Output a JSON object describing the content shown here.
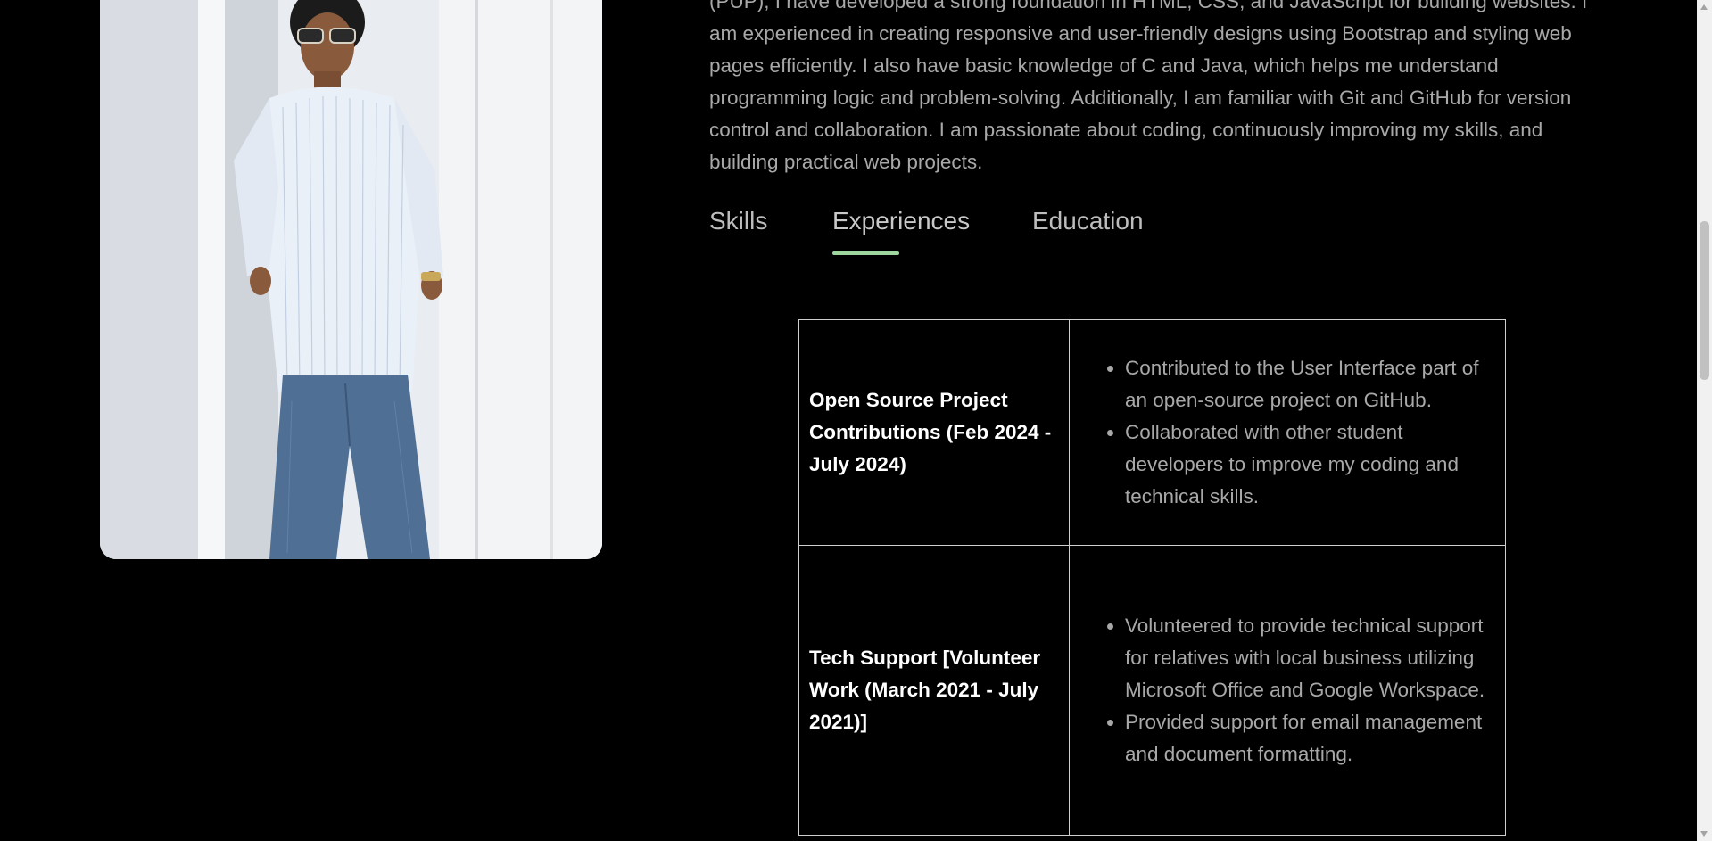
{
  "about": {
    "paragraph": "(PUP), I have developed a strong foundation in HTML, CSS, and JavaScript for building websites. I am experienced in creating responsive and user-friendly designs using Bootstrap and styling web pages efficiently. I also have basic knowledge of C and Java, which helps me understand programming logic and problem-solving. Additionally, I am familiar with Git and GitHub for version control and collaboration. I am passionate about coding, continuously improving my skills, and building practical web projects."
  },
  "tabs": [
    {
      "label": "Skills",
      "active": false
    },
    {
      "label": "Experiences",
      "active": true
    },
    {
      "label": "Education",
      "active": false
    }
  ],
  "experiences": [
    {
      "title": "Open Source Project Contributions (Feb 2024 - July 2024)",
      "bullets": [
        "Contributed to the User Interface part of an open-source project on GitHub.",
        "Collaborated with other student developers to improve my coding and technical skills."
      ]
    },
    {
      "title": "Tech Support [Volunteer Work (March 2021 - July 2021)]",
      "bullets": [
        "Volunteered to provide technical support for relatives with local business utilizing Microsoft Office and Google Workspace.",
        "Provided support for email management and document formatting."
      ]
    }
  ],
  "colors": {
    "background": "#000000",
    "accent": "#9ed69e",
    "text": "#a8a8a8"
  }
}
